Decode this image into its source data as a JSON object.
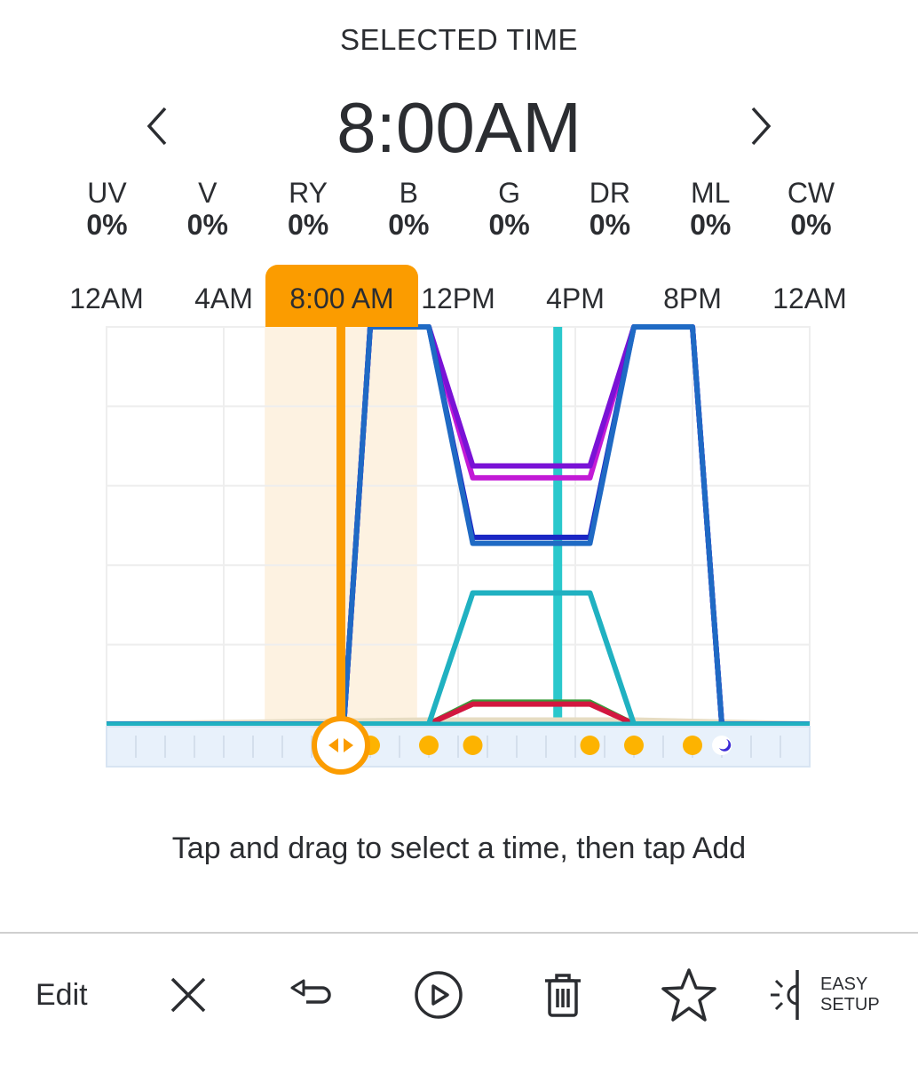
{
  "header": {
    "title": "SELECTED TIME",
    "selected_time": "8:00AM",
    "prev_icon": "chevron-left-icon",
    "next_icon": "chevron-right-icon"
  },
  "channels": [
    {
      "label": "UV",
      "value": "0%"
    },
    {
      "label": "V",
      "value": "0%"
    },
    {
      "label": "RY",
      "value": "0%"
    },
    {
      "label": "B",
      "value": "0%"
    },
    {
      "label": "G",
      "value": "0%"
    },
    {
      "label": "DR",
      "value": "0%"
    },
    {
      "label": "ML",
      "value": "0%"
    },
    {
      "label": "CW",
      "value": "0%"
    }
  ],
  "chart_data": {
    "type": "line",
    "title": "",
    "xlabel": "",
    "ylabel": "",
    "x_unit": "hours",
    "xlim": [
      0,
      24
    ],
    "ylim": [
      0,
      100
    ],
    "grid": true,
    "x_tick_labels": [
      {
        "hour": 0,
        "label": "12AM"
      },
      {
        "hour": 4,
        "label": "4AM"
      },
      {
        "hour": 12,
        "label": "12PM"
      },
      {
        "hour": 16,
        "label": "4PM"
      },
      {
        "hour": 20,
        "label": "8PM"
      },
      {
        "hour": 24,
        "label": "12AM"
      }
    ],
    "selected_hour": 8,
    "selected_label": "8:00 AM",
    "selection_window": [
      5.4,
      10.6
    ],
    "current_time_hour": 15.4,
    "series": [
      {
        "name": "ML",
        "color": "#e6dcc2",
        "x": [
          0,
          11,
          18,
          24
        ],
        "y": [
          0,
          1,
          1,
          0
        ]
      },
      {
        "name": "G",
        "color": "#3a9a3a",
        "x": [
          0,
          11,
          12.5,
          16.5,
          18,
          24
        ],
        "y": [
          0,
          0,
          5.5,
          5.5,
          0,
          0
        ]
      },
      {
        "name": "DR",
        "color": "#d2173f",
        "x": [
          0,
          11,
          12.5,
          16.5,
          18,
          24
        ],
        "y": [
          0,
          0,
          5,
          5,
          0,
          0
        ]
      },
      {
        "name": "RY",
        "color": "#20b1c1",
        "x": [
          0,
          11,
          12.5,
          16.5,
          18,
          24
        ],
        "y": [
          0,
          0,
          33,
          33,
          0,
          0
        ]
      },
      {
        "name": "UV",
        "color": "#c21ad6",
        "x": [
          0,
          8.1,
          9,
          11,
          12.5,
          16.5,
          18,
          20,
          21,
          24
        ],
        "y": [
          0,
          0,
          100,
          100,
          62,
          62,
          100,
          100,
          0,
          0
        ]
      },
      {
        "name": "V",
        "color": "#7a12d6",
        "x": [
          0,
          8.1,
          9,
          11,
          12.5,
          16.5,
          18,
          20,
          21,
          24
        ],
        "y": [
          0,
          0,
          100,
          100,
          65,
          65,
          100,
          100,
          0,
          0
        ]
      },
      {
        "name": "B",
        "color": "#1a26c4",
        "x": [
          0,
          8.1,
          9,
          11,
          12.5,
          16.5,
          18,
          20,
          21,
          24
        ],
        "y": [
          0,
          0,
          100,
          100,
          47,
          47,
          100,
          100,
          0,
          0
        ]
      },
      {
        "name": "CW",
        "color": "#1f6ac4",
        "x": [
          0,
          8.1,
          9,
          11,
          12.5,
          16.5,
          18,
          20,
          21,
          24
        ],
        "y": [
          0,
          0,
          100,
          100,
          45.5,
          45.5,
          100,
          100,
          0,
          0
        ]
      }
    ],
    "points_hours": [
      9,
      11,
      12.5,
      16.5,
      18,
      20
    ],
    "night_point_hour": 21,
    "colors": {
      "selection": "#fb9c00",
      "selection_band": "#fdf2e1",
      "current_time": "#2ac8cc",
      "point": "#fdb300",
      "strip": "#e8f1fb",
      "grid": "#eeeeee"
    }
  },
  "hint": "Tap and drag to select a time, then tap Add",
  "toolbar": {
    "edit_label": "Edit",
    "close_icon": "close-icon",
    "undo_icon": "undo-icon",
    "play_icon": "play-icon",
    "delete_icon": "trash-icon",
    "favorite_icon": "star-icon",
    "easy_setup_line1": "EASY",
    "easy_setup_line2": "SETUP"
  }
}
